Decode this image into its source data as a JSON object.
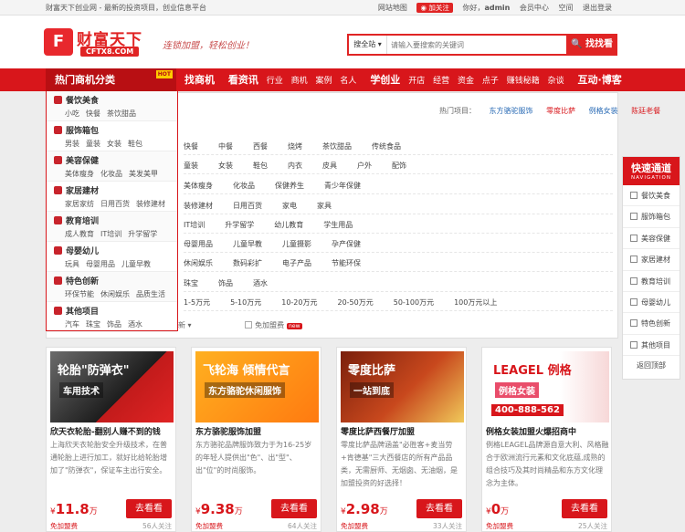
{
  "topbar": {
    "site_desc": "财富天下创业网 - 最新的投资项目，创业信息平台",
    "site_map": "网站地图",
    "weibo": "加关注",
    "greeting": "你好，",
    "user": "admin",
    "member_center": "会员中心",
    "space": "空间",
    "logout": "退出登录"
  },
  "header": {
    "logo_mark": "F",
    "logo_text": "财富天下",
    "logo_url": "CFTX8.COM",
    "slogan": "连锁加盟，轻松创业！",
    "search_category": "搜全站",
    "search_placeholder": "请输入要搜索的关键词",
    "search_button": "找找看"
  },
  "nav": {
    "hot_label": "热门商机分类",
    "hot_tag": "HOT",
    "groups": [
      {
        "main": "找商机",
        "subs": []
      },
      {
        "main": "看资讯",
        "subs": [
          "行业",
          "商机",
          "案例",
          "名人"
        ]
      },
      {
        "main": "学创业",
        "subs": [
          "开店",
          "经营",
          "资金",
          "点子",
          "赚钱秘籍",
          "杂谈"
        ]
      },
      {
        "main": "互动·博客",
        "subs": []
      }
    ]
  },
  "hot_projects": {
    "label": "热门项目：",
    "items": [
      "东方骆驼服饰",
      "零度比萨",
      "例格女装",
      "陈廷老餐"
    ]
  },
  "filter_rows": [
    [
      "快餐",
      "中餐",
      "西餐",
      "烧烤",
      "茶饮甜品",
      "传统食品"
    ],
    [
      "童装",
      "女装",
      "鞋包",
      "内衣",
      "皮具",
      "户外",
      "配饰"
    ],
    [
      "美体瘦身",
      "化妆品",
      "保健养生",
      "青少年保健"
    ],
    [
      "装修建材",
      "日用百货",
      "家电",
      "家具"
    ],
    [
      "IT培训",
      "升学留学",
      "幼儿教育",
      "学生用品"
    ],
    [
      "母婴用品",
      "儿童早教",
      "儿童摄影",
      "孕产保健"
    ],
    [
      "休闲娱乐",
      "数码彩扩",
      "电子产品",
      "节能环保"
    ],
    [
      "珠宝",
      "饰品",
      "酒水"
    ],
    [
      "1-5万元",
      "5-10万元",
      "10-20万元",
      "20-50万元",
      "50-100万元",
      "100万元以上"
    ]
  ],
  "categories": [
    {
      "title": "餐饮美食",
      "subs": [
        "小吃",
        "快餐",
        "茶饮甜品"
      ]
    },
    {
      "title": "服饰箱包",
      "subs": [
        "男装",
        "童装",
        "女装",
        "鞋包"
      ]
    },
    {
      "title": "美容保健",
      "subs": [
        "美体瘦身",
        "化妆品",
        "美发美甲"
      ]
    },
    {
      "title": "家居建材",
      "subs": [
        "家居家纺",
        "日用百货",
        "装修建材"
      ]
    },
    {
      "title": "教育培训",
      "subs": [
        "成人教育",
        "IT培训",
        "升学留学"
      ]
    },
    {
      "title": "母婴幼儿",
      "subs": [
        "玩具",
        "母婴用品",
        "儿童早教"
      ]
    },
    {
      "title": "特色创新",
      "subs": [
        "环保节能",
        "休闲娱乐",
        "品质生活"
      ]
    },
    {
      "title": "其他项目",
      "subs": [
        "汽车",
        "珠宝",
        "饰品",
        "酒水"
      ]
    }
  ],
  "sortbar": {
    "label": "新",
    "free_label": "免加盟费",
    "new_tag": "new"
  },
  "sidenav": {
    "title": "快速通道",
    "subtitle": "NAVIGATION",
    "items": [
      "餐饮美食",
      "服饰箱包",
      "美容保健",
      "家居建材",
      "教育培训",
      "母婴幼儿",
      "特色创新",
      "其他项目"
    ],
    "back_top": "返回顶部"
  },
  "cards": [
    {
      "img_text": "轮胎\"防弹衣\"",
      "img_sub": "车用技术",
      "title": "欣天衣轮胎-翻别人赚不到的钱",
      "desc": "上海欣天衣轮胎安全升级技术，在普通轮胎上进行加工，就好比给轮胎增加了\"防弹衣\"，保证车主出行安全。",
      "currency": "¥",
      "price": "11.8",
      "unit": "万",
      "free": "免加盟费",
      "see": "去看看",
      "attention": "56人关注"
    },
    {
      "img_text": "飞轮海 倾情代言",
      "img_sub": "东方骆驼休闲服饰",
      "title": "东方骆驼服饰加盟",
      "desc": "东方骆驼品牌服饰致力于为16-25岁的年轻人提供出\"色\"、出\"型\"、出\"位\"的时尚服饰。",
      "currency": "¥",
      "price": "9.38",
      "unit": "万",
      "free": "免加盟费",
      "see": "去看看",
      "attention": "64人关注"
    },
    {
      "img_text": "零度比萨",
      "img_sub": "一站到底",
      "title": "零度比萨西餐厅加盟",
      "desc": "零度比萨品牌涵盖\"必胜客+麦当劳+肯德基\"三大西餐店的所有产品品类，无需厨师、无烟囱、无油烟，是加盟投资的好选择！",
      "currency": "¥",
      "price": "2.98",
      "unit": "万",
      "free": "免加盟费",
      "see": "去看看",
      "attention": "33人关注"
    },
    {
      "img_text": "LEAGEL 例格",
      "img_sub": "例格女装",
      "img_phone": "400-888-562",
      "title": "例格女装加盟火爆招商中",
      "desc": "例格LEAGEL品牌源自意大利、风格融合于欧洲流行元素和文化底蕴,成熟的组合技巧及其时尚精品和东方文化理念为主体。",
      "currency": "¥",
      "price": "0",
      "unit": "万",
      "free": "免加盟费",
      "see": "去看看",
      "attention": "25人关注"
    }
  ]
}
